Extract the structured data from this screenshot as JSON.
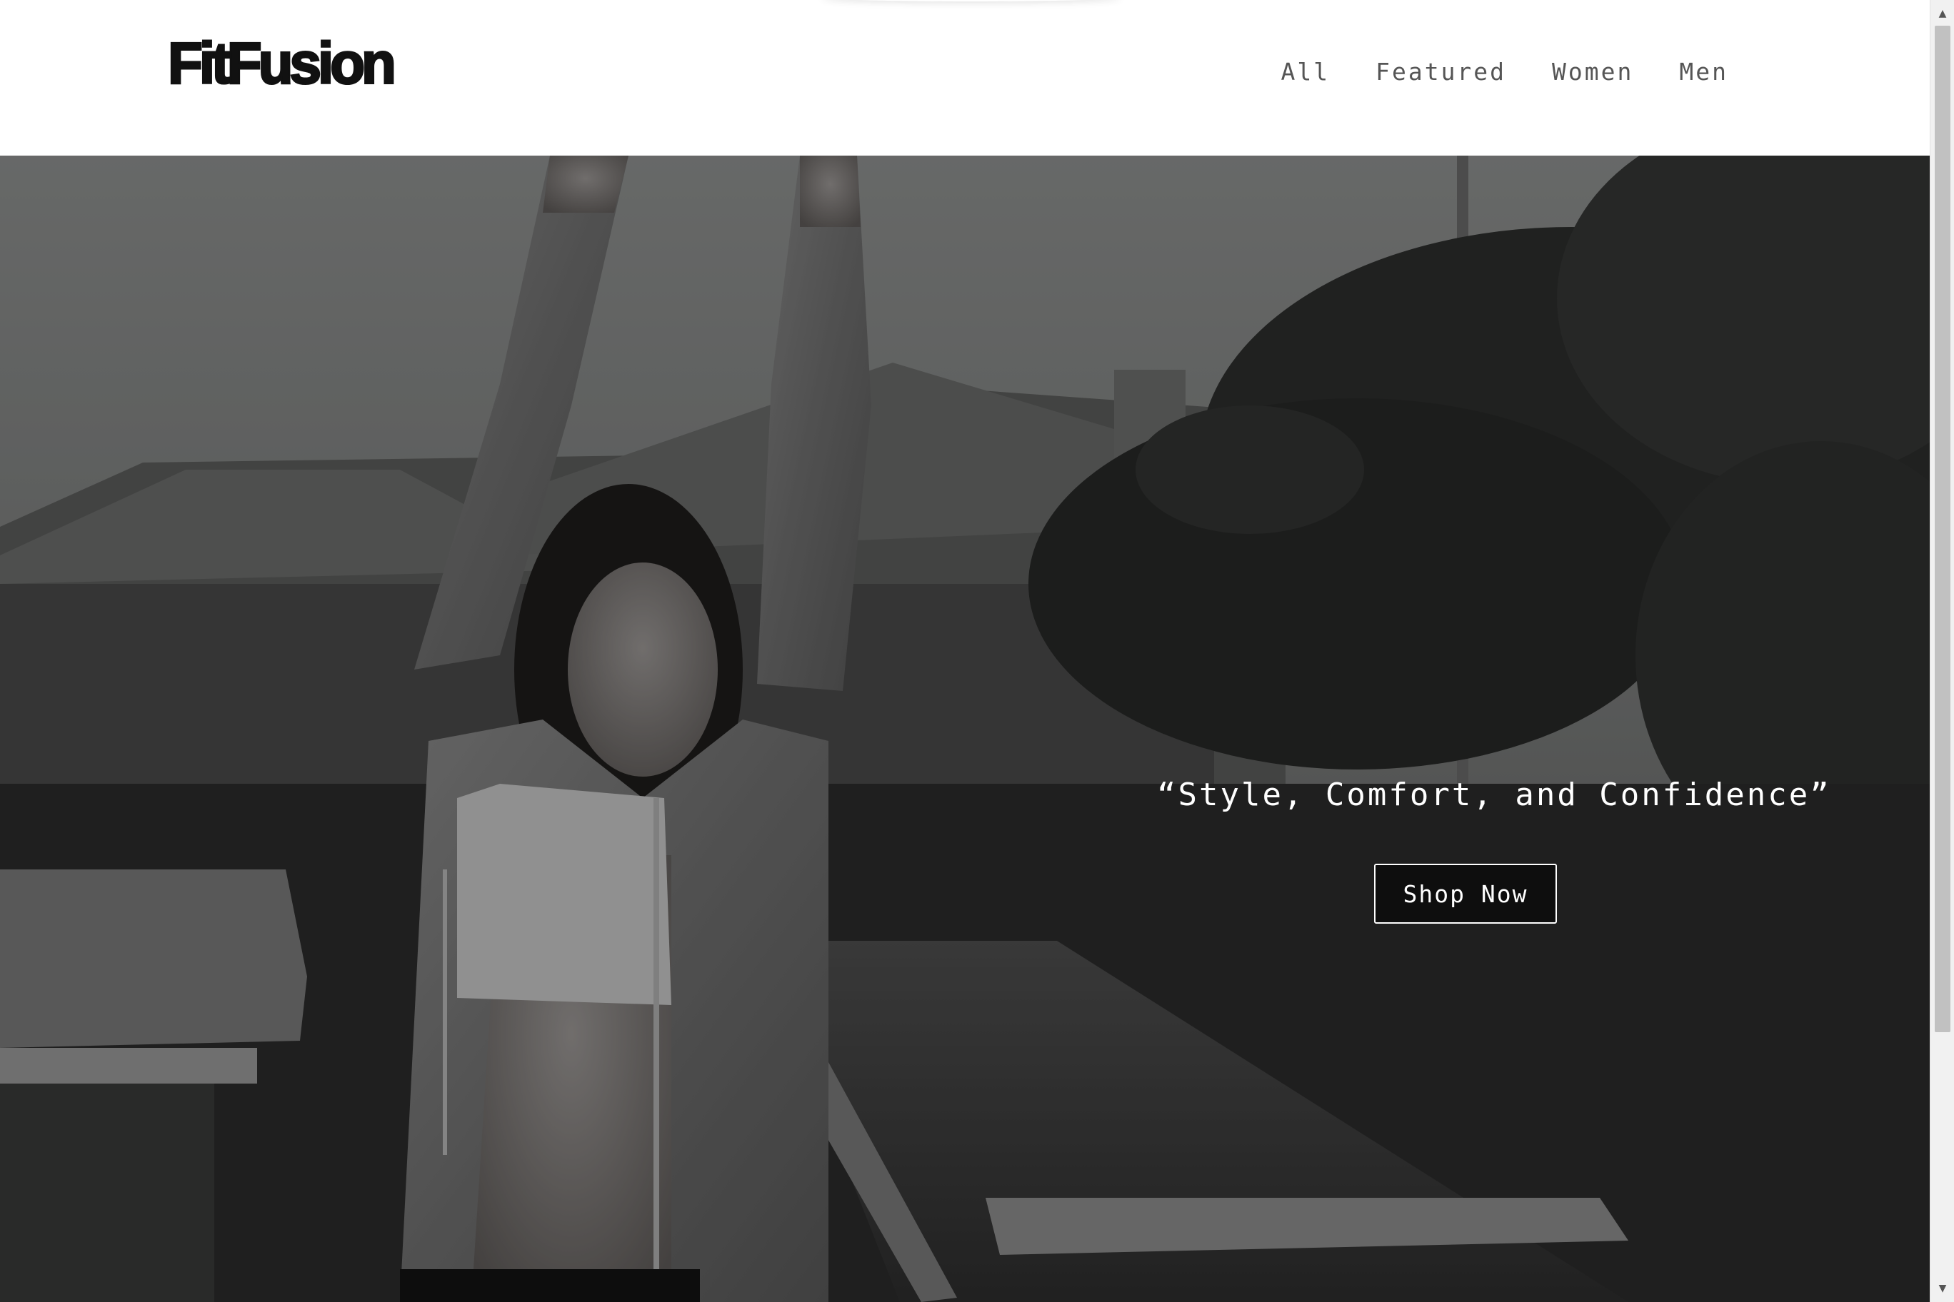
{
  "header": {
    "logo": "FitFusion",
    "nav": [
      "All",
      "Featured",
      "Women",
      "Men"
    ]
  },
  "hero": {
    "image": "black-and-white photo of a woman in a grey zip hoodie and white sports bra stretching her arms overhead on a dock",
    "tagline": "“Style, Comfort, and Confidence”",
    "cta_label": "Shop Now"
  },
  "scrollbar": {
    "up_icon": "chevron-up-icon",
    "down_icon": "chevron-down-icon"
  },
  "colors": {
    "background": "#ffffff",
    "logo": "#111111",
    "nav_text": "#555555",
    "hero_text": "#ffffff"
  }
}
